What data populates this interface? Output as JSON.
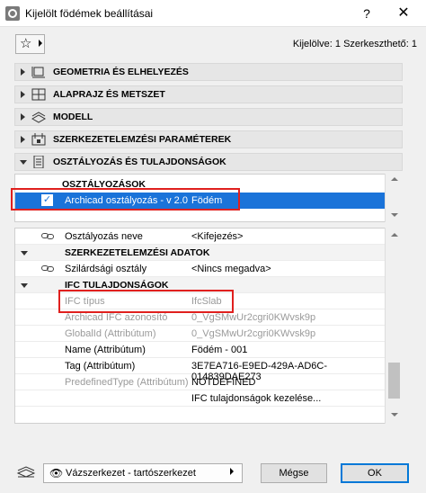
{
  "window": {
    "title": "Kijelölt födémek beállításai",
    "help_label": "?",
    "close_label": "✕"
  },
  "toolbar": {
    "favorites_icon": "star-icon",
    "selection_info": "Kijelölve: 1 Szerkeszthető: 1"
  },
  "panels": [
    {
      "label": "GEOMETRIA ÉS ELHELYEZÉS",
      "icon": "geometry-icon",
      "expanded": false
    },
    {
      "label": "ALAPRAJZ ÉS METSZET",
      "icon": "floorplan-icon",
      "expanded": false
    },
    {
      "label": "MODELL",
      "icon": "model-icon",
      "expanded": false
    },
    {
      "label": "SZERKEZETELEMZÉSI PARAMÉTEREK",
      "icon": "structural-icon",
      "expanded": false
    },
    {
      "label": "OSZTÁLYOZÁS ÉS TULAJDONSÁGOK",
      "icon": "properties-icon",
      "expanded": true
    }
  ],
  "classifications": {
    "header": "OSZTÁLYOZÁSOK",
    "row": {
      "name": "Archicad osztályozás - v 2.0",
      "value": "Födém",
      "checked": true
    }
  },
  "properties": {
    "rows": [
      {
        "kind": "item",
        "name": "Osztályozás neve",
        "value": "<Kifejezés>",
        "linked": true
      },
      {
        "kind": "section",
        "name": "SZERKEZETELEMZÉSI ADATOK"
      },
      {
        "kind": "item",
        "name": "Szilárdsági osztály",
        "value": "<Nincs megadva>",
        "linked": true
      },
      {
        "kind": "section",
        "name": "IFC TULAJDONSÁGOK"
      },
      {
        "kind": "item",
        "name": "IFC típus",
        "value": "IfcSlab",
        "dim": true
      },
      {
        "kind": "item",
        "name": "Archicad IFC azonosító",
        "value": "0_VgSMwUr2cgri0KWvsk9p",
        "dim": true
      },
      {
        "kind": "item",
        "name": "GlobalId (Attribútum)",
        "value": "0_VgSMwUr2cgri0KWvsk9p",
        "dim": true
      },
      {
        "kind": "item",
        "name": "Name (Attribútum)",
        "value": "Födém - 001"
      },
      {
        "kind": "item",
        "name": "Tag (Attribútum)",
        "value": "3E7EA716-E9ED-429A-AD6C-014839DAE273"
      },
      {
        "kind": "item",
        "name": "PredefinedType (Attribútum)",
        "value": "NOTDEFINED",
        "dim_name": true
      },
      {
        "kind": "item",
        "name": "",
        "value": "IFC tulajdonságok kezelése..."
      }
    ]
  },
  "footer": {
    "view_icon": "eye-icon",
    "view_label": "Vázszerkezet - tartószerkezet",
    "cancel_label": "Mégse",
    "ok_label": "OK"
  },
  "colors": {
    "selection": "#1a73d9",
    "highlight_box": "#e0201e"
  }
}
